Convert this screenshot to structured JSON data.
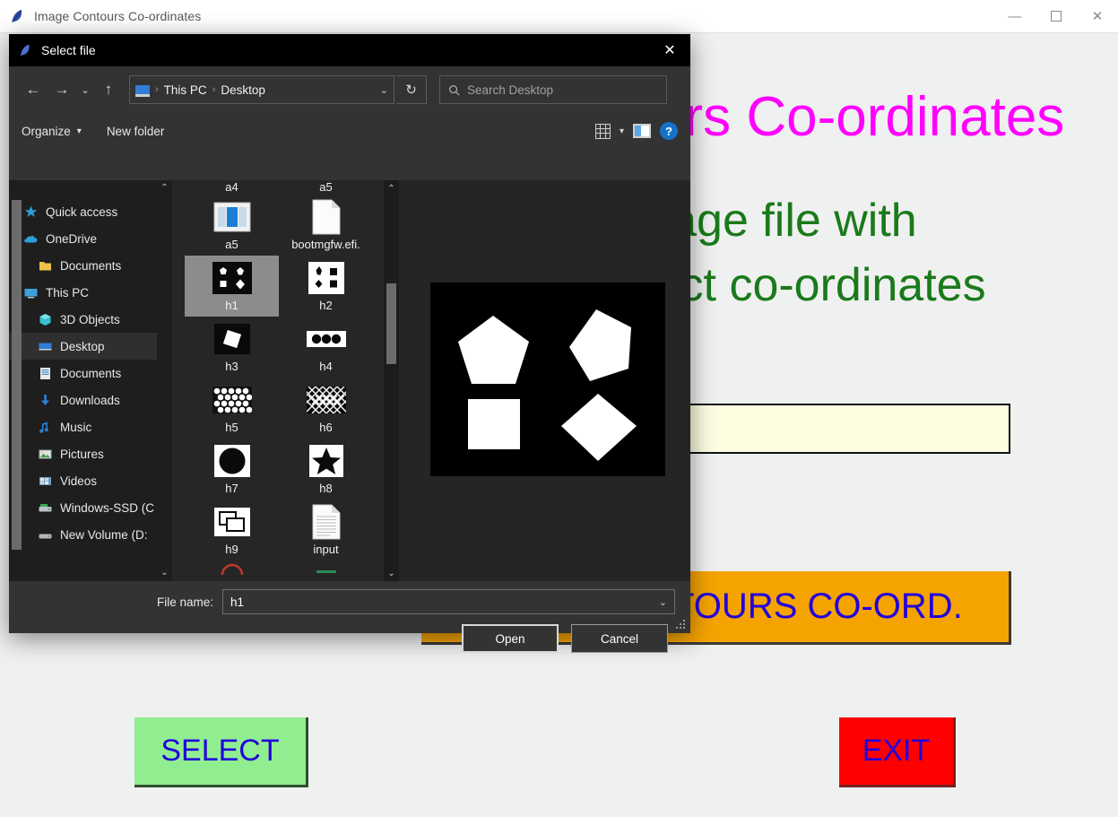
{
  "app": {
    "title": "Image Contours Co-ordinates",
    "title_icon": "feather-icon",
    "window_controls": {
      "minimize": "—",
      "maximize": "☐",
      "close": "✕"
    },
    "headline_magenta": "Image Contours Co-ordinates",
    "headline_green_line1": "Select an image file with",
    "headline_green_line2": "shapes to extract co-ordinates",
    "path_display_value": "",
    "contours_button_label": "IMAGE CONTOURS CO-ORD.",
    "select_button_label": "SELECT",
    "exit_button_label": "EXIT",
    "colors": {
      "magenta": "#ff00ff",
      "green": "#1a7a1a",
      "orange": "#f5a300",
      "blue_text": "#2200dd",
      "select_green": "#90ee90",
      "exit_red": "#ff0000",
      "path_field": "#fdfde2",
      "window_bg": "#eff0f0"
    }
  },
  "dialog": {
    "title": "Select file",
    "title_icon": "feather-icon",
    "close_icon": "✕",
    "nav": {
      "back_icon": "←",
      "forward_icon": "→",
      "recent_icon": "⌄",
      "up_icon": "↑",
      "breadcrumb": [
        "This PC",
        "Desktop"
      ],
      "breadcrumb_sep": "›",
      "breadcrumb_chevron": "⌄",
      "refresh_icon": "↻",
      "search_placeholder": "Search Desktop",
      "search_icon": "search-icon"
    },
    "toolbar": {
      "organize_label": "Organize",
      "organize_caret": "▾",
      "new_folder_label": "New folder",
      "view_caret": "▾",
      "help_label": "?"
    },
    "sidebar": {
      "items": [
        {
          "label": "Quick access",
          "icon": "star-icon",
          "indent": false,
          "selected": false
        },
        {
          "label": "OneDrive",
          "icon": "cloud-icon",
          "indent": false,
          "selected": false
        },
        {
          "label": "Documents",
          "icon": "folder-icon",
          "indent": true,
          "selected": false
        },
        {
          "label": "This PC",
          "icon": "monitor-icon",
          "indent": false,
          "selected": false
        },
        {
          "label": "3D Objects",
          "icon": "cube-icon",
          "indent": true,
          "selected": false
        },
        {
          "label": "Desktop",
          "icon": "desktop-icon",
          "indent": true,
          "selected": true
        },
        {
          "label": "Documents",
          "icon": "document-icon",
          "indent": true,
          "selected": false
        },
        {
          "label": "Downloads",
          "icon": "download-icon",
          "indent": true,
          "selected": false
        },
        {
          "label": "Music",
          "icon": "music-icon",
          "indent": true,
          "selected": false
        },
        {
          "label": "Pictures",
          "icon": "picture-icon",
          "indent": true,
          "selected": false
        },
        {
          "label": "Videos",
          "icon": "video-icon",
          "indent": true,
          "selected": false
        },
        {
          "label": "Windows-SSD (C",
          "icon": "drive-icon",
          "indent": true,
          "selected": false
        },
        {
          "label": "New Volume (D:",
          "icon": "drive-icon",
          "indent": true,
          "selected": false
        }
      ],
      "scroll_up": "⌃",
      "scroll_down": "⌄"
    },
    "file_list": {
      "cut_top_labels": [
        "a4",
        "a5"
      ],
      "files": [
        {
          "label": "a5",
          "thumb": "picture-thumb",
          "selected": false
        },
        {
          "label": "bootmgfw.efi.",
          "thumb": "blank-document-thumb",
          "selected": false
        },
        {
          "label": "h1",
          "thumb": "shapes-dark-thumb",
          "selected": true
        },
        {
          "label": "h2",
          "thumb": "shapes-light-thumb",
          "selected": false
        },
        {
          "label": "h3",
          "thumb": "square-dark-thumb",
          "selected": false
        },
        {
          "label": "h4",
          "thumb": "three-dots-thumb",
          "selected": false
        },
        {
          "label": "h5",
          "thumb": "circles-pattern-thumb",
          "selected": false
        },
        {
          "label": "h6",
          "thumb": "mesh-pattern-thumb",
          "selected": false
        },
        {
          "label": "h7",
          "thumb": "circle-thumb",
          "selected": false
        },
        {
          "label": "h8",
          "thumb": "star-thumb",
          "selected": false
        },
        {
          "label": "h9",
          "thumb": "rectangles-thumb",
          "selected": false
        },
        {
          "label": "input",
          "thumb": "text-document-thumb",
          "selected": false
        }
      ],
      "scroll_up": "⌃",
      "scroll_down": "⌄"
    },
    "preview": {
      "alt": "Black image with four white shapes",
      "shapes": [
        {
          "name": "pentagon",
          "position": "top-left"
        },
        {
          "name": "pentagon-rotated",
          "position": "top-right"
        },
        {
          "name": "square",
          "position": "bottom-left"
        },
        {
          "name": "diamond",
          "position": "bottom-right"
        }
      ]
    },
    "filename_label": "File name:",
    "filename_value": "h1",
    "filename_chevron": "⌄",
    "open_label": "Open",
    "cancel_label": "Cancel"
  }
}
